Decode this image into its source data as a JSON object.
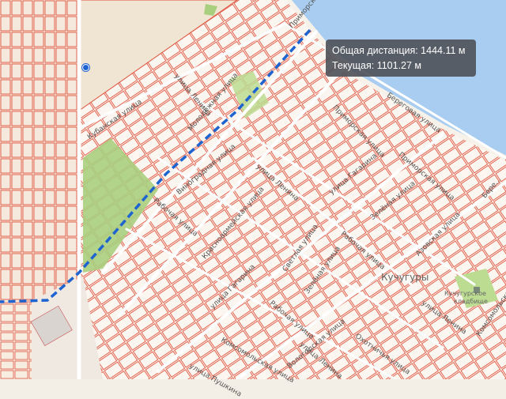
{
  "info_panel": {
    "total_distance": "Общая дистанция: 1444.11 м",
    "current_distance": "Текущая: 1101.27 м"
  },
  "place_labels": {
    "kuchugury": "Кучугуры",
    "cemetery_line1": "Кучугурское",
    "cemetery_line2": "кладбище"
  },
  "street_labels": [
    "Приморская улица",
    "улица Ленина",
    "Молодёжная улица",
    "Кубанская улица",
    "Рабочая улица",
    "Виноградная улица",
    "Красноармейская улица",
    "улица Ленина",
    "улица Гагарина",
    "Береговая улица",
    "Приморская улица",
    "Приморская улица",
    "Зелёная улица",
    "Светлая улица",
    "Рабочая улица",
    "Зелёная улица",
    "Азовская улица",
    "улица Ленина",
    "Бере...",
    "улица Гагарина",
    "Рабочая улица",
    "Комсомольская улица",
    "улица Пушкина",
    "Охотничья улица",
    "Вологодская улица",
    "улица Ленина",
    "Комсомольская"
  ],
  "colors": {
    "sea": "#a9cdf0",
    "land": "#f4efe6",
    "parcel": "#e0533f",
    "green": "#a8cf7e",
    "road": "#ffffff",
    "route": "#1e64d0"
  }
}
